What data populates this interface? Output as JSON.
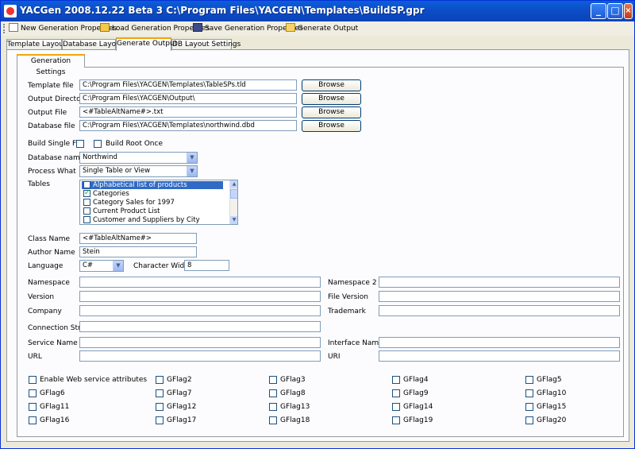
{
  "window": {
    "title": "YACGen 2008.12.22 Beta 3 C:\\Program Files\\YACGEN\\Templates\\BuildSP.gpr"
  },
  "toolbar": {
    "new_label": "New Generation Properties",
    "load_label": "Load Generation Properties",
    "save_label": "Save Generation Properties",
    "generate_label": "Generate Output"
  },
  "tabs": [
    "Template Layout",
    "Database Layout",
    "Generate Output",
    "DB Layout Settings"
  ],
  "subtab": "Generation Settings",
  "browse_label": "Browse",
  "form": {
    "template_file_label": "Template file",
    "template_file": "C:\\Program Files\\YACGEN\\Templates\\TableSPs.tld",
    "output_directory_label": "Output Directory",
    "output_directory": "C:\\Program Files\\YACGEN\\Output\\",
    "output_file_label": "Output File",
    "output_file": "<#TableAltName#>.txt",
    "database_file_label": "Database file",
    "database_file": "C:\\Program Files\\YACGEN\\Templates\\northwind.dbd",
    "build_single_file_label": "Build Single File",
    "build_root_once_label": "Build Root Once",
    "database_name_label": "Database name",
    "database_name": "Northwind",
    "process_what_label": "Process What",
    "process_what": "Single Table or View",
    "tables_label": "Tables",
    "tables": [
      {
        "name": "Alphabetical list of products",
        "checked": false,
        "selected": true
      },
      {
        "name": "Categories",
        "checked": true,
        "selected": false
      },
      {
        "name": "Category Sales for 1997",
        "checked": false,
        "selected": false
      },
      {
        "name": "Current Product List",
        "checked": false,
        "selected": false
      },
      {
        "name": "Customer and Suppliers by City",
        "checked": false,
        "selected": false
      }
    ],
    "class_name_label": "Class Name",
    "class_name": "<#TableAltName#>",
    "author_name_label": "Author Name",
    "author_name": "Stein",
    "language_label": "Language",
    "language": "C#",
    "character_width_label": "Character Width",
    "character_width": "8",
    "namespace_label": "Namespace",
    "namespace2_label": "Namespace 2",
    "version_label": "Version",
    "file_version_label": "File Version",
    "company_label": "Company",
    "trademark_label": "Trademark",
    "connection_string_label": "Connection String",
    "service_name_label": "Service Name",
    "interface_name_label": "Interface Name",
    "url_label": "URL",
    "uri_label": "URI"
  },
  "flags": [
    "Enable Web service attributes",
    "GFlag2",
    "GFlag3",
    "GFlag4",
    "GFlag5",
    "GFlag6",
    "GFlag7",
    "GFlag8",
    "GFlag9",
    "GFlag10",
    "GFlag11",
    "GFlag12",
    "GFlag13",
    "GFlag14",
    "GFlag15",
    "GFlag16",
    "GFlag17",
    "GFlag18",
    "GFlag19",
    "GFlag20"
  ],
  "icons": {
    "minimize": "minimize-icon",
    "maximize": "maximize-icon",
    "close": "close-icon"
  }
}
